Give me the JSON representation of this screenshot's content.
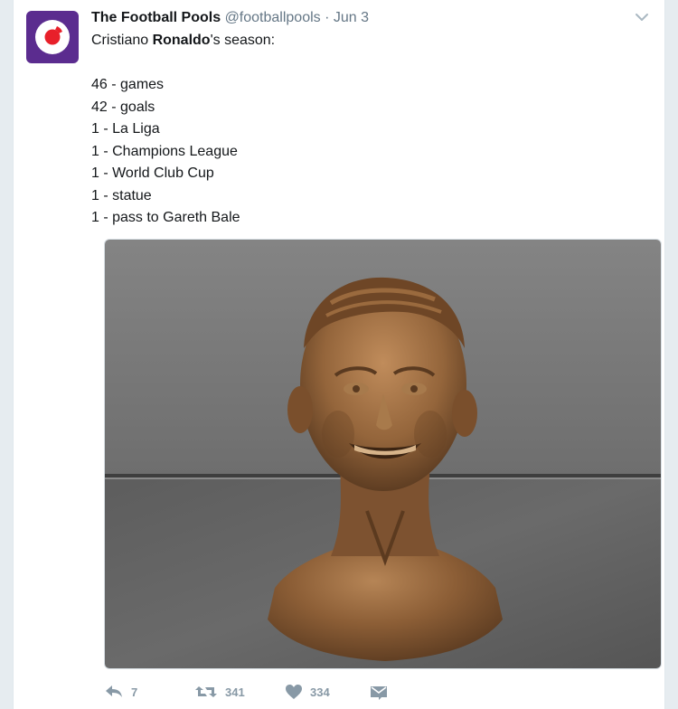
{
  "tweet": {
    "author_name": "The Football Pools",
    "handle": "@footballpools",
    "separator": "·",
    "date": "Jun 3",
    "text_line1_pre": "Cristiano ",
    "text_line1_bold": "Ronaldo",
    "text_line1_post": "'s season:",
    "stats": [
      "46 - games",
      "42 - goals",
      "1 - La Liga",
      "1 - Champions League",
      "1 - World Club Cup",
      "1 - statue",
      "1 - pass to Gareth Bale"
    ]
  },
  "actions": {
    "reply_count": "7",
    "retweet_count": "341",
    "like_count": "334"
  },
  "colors": {
    "avatar_bg": "#5b2c8f",
    "logo_red": "#e8202a",
    "icon_gray": "#8899a6",
    "name_text": "#14171a",
    "meta_text": "#657786"
  },
  "icons": {
    "reply": "reply-icon",
    "retweet": "retweet-icon",
    "like": "heart-icon",
    "dm": "envelope-icon",
    "more": "chevron-down-icon"
  }
}
